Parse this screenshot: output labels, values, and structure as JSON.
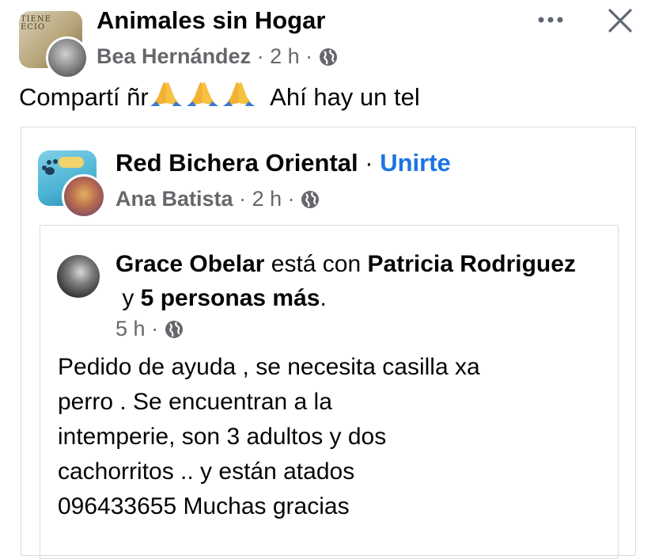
{
  "post": {
    "group_name": "Animales sin Hogar",
    "group_logo_text": "TIENE\nECIO",
    "poster_name": "Bea Hernández",
    "time": "2 h",
    "separator": "·",
    "text_before": "Compartí ñr",
    "text_after": "  Ahí hay un tel",
    "emoji_icon": "folded-hands-icon",
    "emoji_count": 3
  },
  "shared": {
    "group_name": "Red Bichera Oriental",
    "join_label": "Unirte",
    "separator": "·",
    "poster_name": "Ana Batista",
    "time": "2 h"
  },
  "original": {
    "author": "Grace Obelar",
    "with_text": " está con ",
    "tagged": "Patricia Rodriguez",
    "and_text": " y ",
    "others": "5 personas más",
    "period": ".",
    "time": "5 h",
    "separator": "·",
    "body": "Pedido de ayuda , se necesita casilla xa\nperro . Se encuentran a la\n intemperie, son 3 adultos y dos\ncachorritos .. y están atados\n096433655 Muchas gracias"
  },
  "colors": {
    "accent": "#1b74e4",
    "secondary_text": "#65676b",
    "border": "#d9dadc"
  },
  "icons": {
    "more": "more-horizontal-icon",
    "close": "close-icon",
    "privacy": "globe-icon"
  }
}
